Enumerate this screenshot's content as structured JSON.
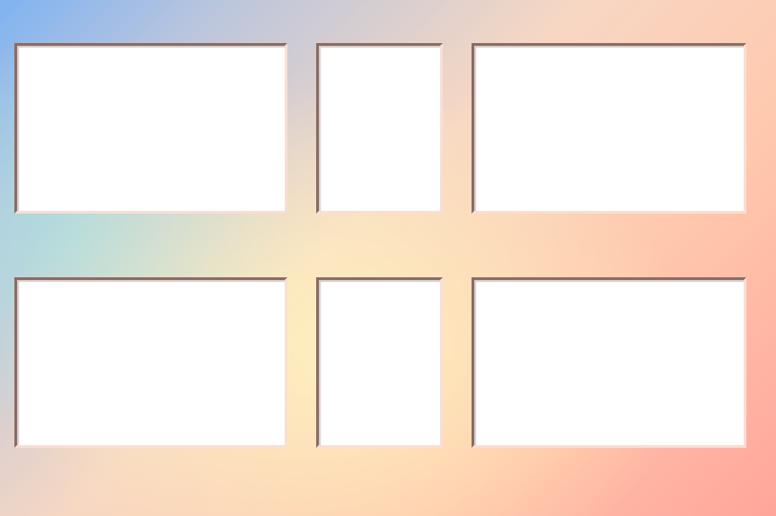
{
  "background": {
    "colors": [
      "#7fb3f2",
      "#aae1e1",
      "#fff4be",
      "#ffc8ad",
      "#ff9a76",
      "#ffa59a"
    ]
  },
  "frames": {
    "fill_color": "#ffffff",
    "edge_dark": "#8a6c62",
    "edge_light": "#f7dfd5",
    "count": 6
  }
}
